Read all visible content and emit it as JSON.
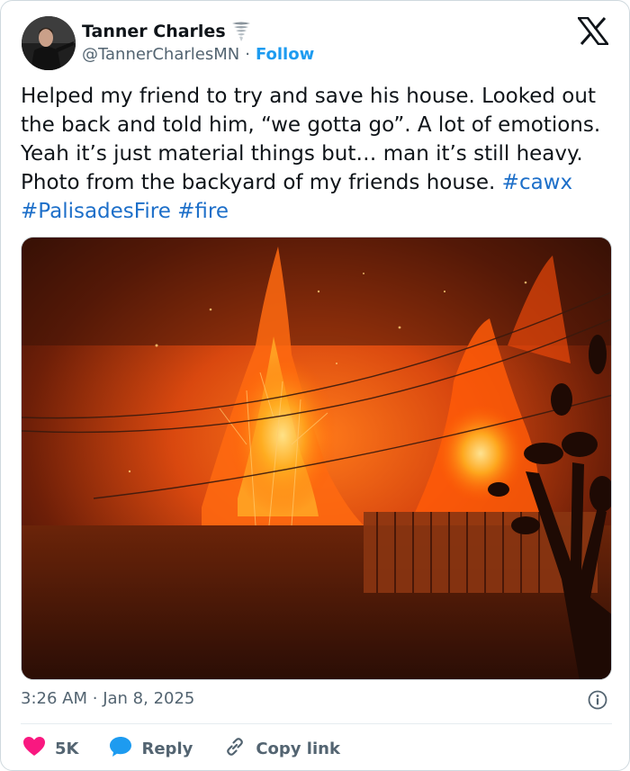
{
  "author": {
    "name": "Tanner Charles",
    "handle": "@TannerCharlesMN",
    "separator": "·",
    "follow_label": "Follow"
  },
  "tweet": {
    "text": "Helped my friend to try and save his house. Looked out the back and told him, “we gotta go”. A lot of emotions. Yeah it’s just material things but… man it’s still heavy. Photo from the backyard of my friends house. ",
    "hashtags": [
      "#cawx",
      "#PalisadesFire",
      "#fire"
    ]
  },
  "meta": {
    "time": "3:26 AM",
    "separator": "·",
    "date": "Jan 8, 2025"
  },
  "actions": {
    "likes": "5K",
    "reply_label": "Reply",
    "copy_label": "Copy link"
  },
  "colors": {
    "accent": "#1d9bf0",
    "like": "#f91880",
    "reply_icon": "#1d9bf0"
  },
  "icons": {
    "badge": "tornado-icon",
    "logo": "x-logo-icon",
    "info": "info-icon",
    "like": "heart-icon",
    "reply": "speech-bubble-icon",
    "copy": "link-icon"
  }
}
